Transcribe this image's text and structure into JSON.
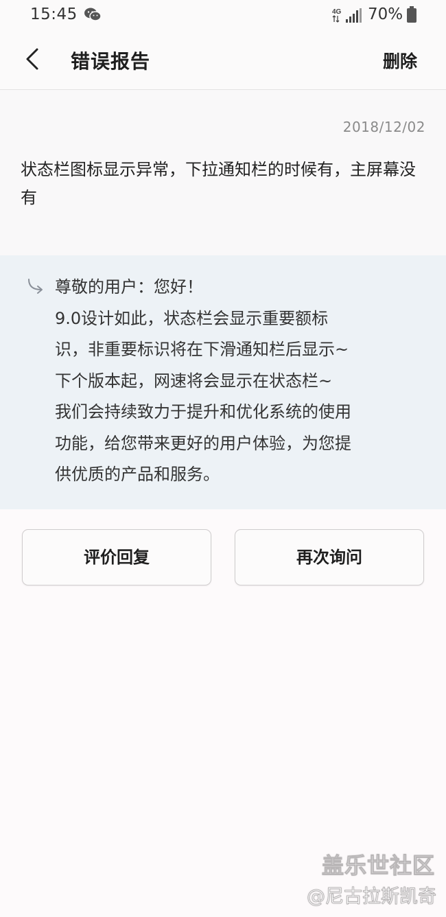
{
  "status_bar": {
    "time": "15:45",
    "battery": "70%",
    "network": "4G",
    "icons": [
      "wechat-icon",
      "network-signal-icon",
      "battery-icon"
    ]
  },
  "header": {
    "title": "错误报告",
    "delete_label": "删除",
    "back_icon": "chevron-left-icon"
  },
  "report": {
    "date": "2018/12/02",
    "text": "状态栏图标显示异常，下拉通知栏的时候有，主屏幕没有"
  },
  "reply": {
    "icon": "reply-arrow-icon",
    "lines": [
      "尊敬的用户：您好！",
      "9.0设计如此，状态栏会显示重要额标",
      "识，非重要标识将在下滑通知栏后显示~",
      "下个版本起，网速将会显示在状态栏~",
      "我们会持续致力于提升和优化系统的使用",
      "功能，给您带来更好的用户体验，为您提",
      "供优质的产品和服务。"
    ]
  },
  "actions": {
    "rate_reply_label": "评价回复",
    "ask_again_label": "再次询问"
  },
  "watermark": {
    "title": "盖乐世社区",
    "author": "@尼古拉斯凯奇"
  },
  "colors": {
    "page_background": "#fdfafb",
    "reply_background": "#edf2f6",
    "date_text": "#8a8a8a",
    "button_border": "#cfcccd"
  }
}
